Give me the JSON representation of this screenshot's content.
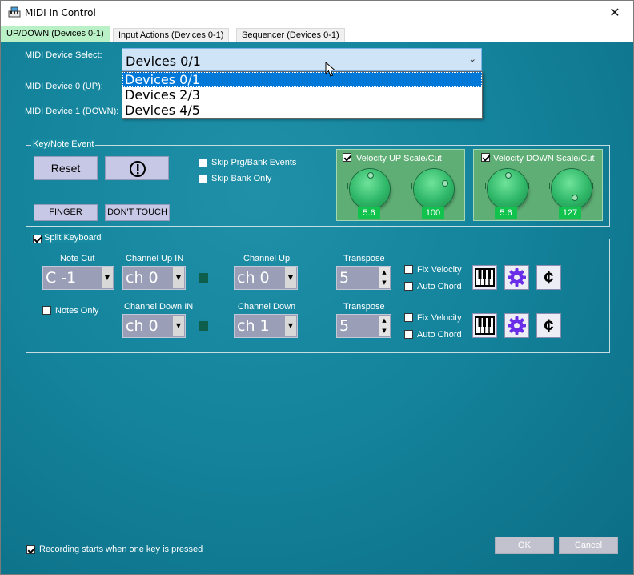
{
  "window": {
    "title": "MIDI In Control",
    "close": "✕"
  },
  "tabs": [
    "UP/DOWN (Devices 0-1)",
    "Input Actions (Devices 0-1)",
    "Sequencer (Devices 0-1)"
  ],
  "device": {
    "select_label": "MIDI Device Select:",
    "selected": "Devices 0/1",
    "options": [
      "Devices 0/1",
      "Devices 2/3",
      "Devices 4/5"
    ],
    "dev0_label": "MIDI Device 0 (UP):",
    "dev1_label": "MIDI Device 1 (DOWN):"
  },
  "key_note": {
    "title": "Key/Note Event",
    "reset": "Reset",
    "alert_icon": "!",
    "finger": "FINGER",
    "dont_touch": "DON'T TOUCH",
    "skip_prg": "Skip Prg/Bank Events",
    "skip_bank": "Skip Bank Only",
    "vel_up_title": "Velocity UP Scale/Cut",
    "vel_up_scale": "5.6",
    "vel_up_cut": "100",
    "vel_down_title": "Velocity DOWN Scale/Cut",
    "vel_down_scale": "5.6",
    "vel_down_cut": "127"
  },
  "split": {
    "title": "Split Keyboard",
    "note_cut_label": "Note Cut",
    "note_cut": "C -1",
    "notes_only": "Notes Only",
    "ch_up_in_label": "Channel Up IN",
    "ch_up_in": "ch 0",
    "ch_up_label": "Channel Up",
    "ch_up": "ch 0",
    "transpose_label": "Transpose",
    "transpose_up": "5",
    "fix_velocity": "Fix Velocity",
    "auto_chord": "Auto Chord",
    "ch_down_in_label": "Channel Down IN",
    "ch_down_in": "ch 0",
    "ch_down_label": "Channel Down",
    "ch_down": "ch 1",
    "transpose_down": "5",
    "cent_symbol": "¢"
  },
  "footer": {
    "recording": "Recording starts when one key is pressed",
    "ok": "OK",
    "cancel": "Cancel"
  }
}
